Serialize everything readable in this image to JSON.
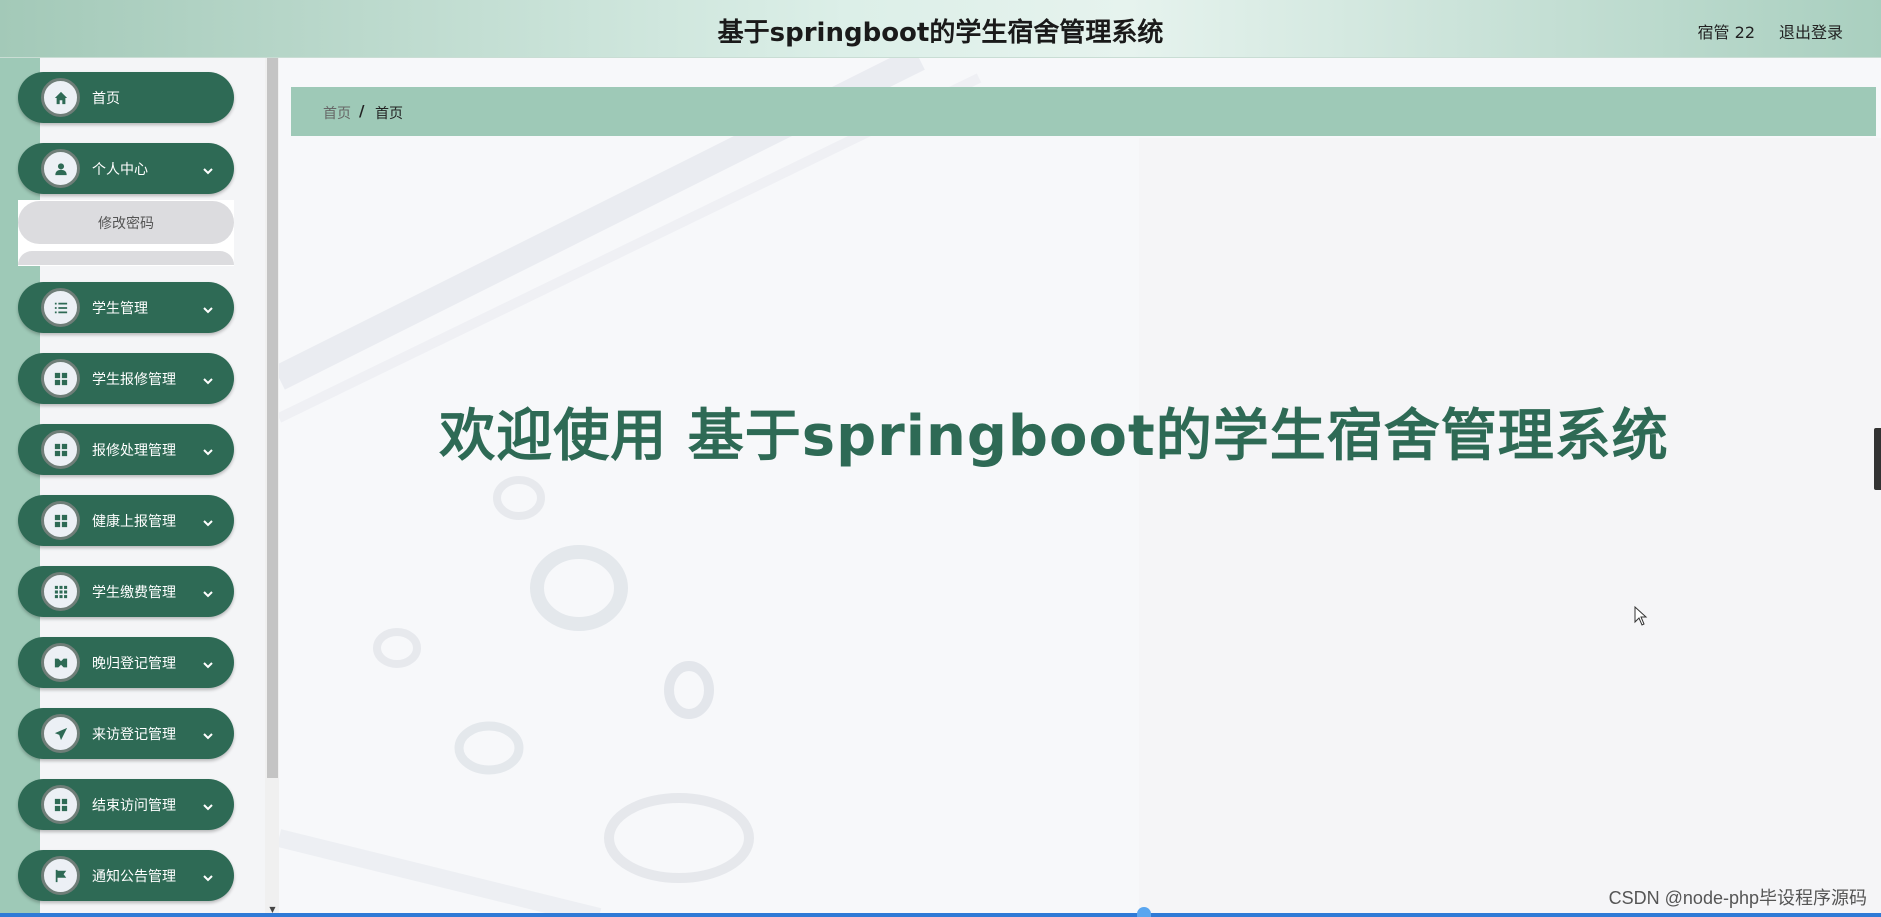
{
  "header": {
    "title": "基于springboot的学生宿舍管理系统",
    "user": "宿管 22",
    "logout": "退出登录"
  },
  "sidebar": {
    "items": [
      {
        "label": "首页",
        "icon": "home-icon"
      },
      {
        "label": "个人中心",
        "icon": "user-icon"
      },
      {
        "label": "学生管理",
        "icon": "list-icon"
      },
      {
        "label": "学生报修管理",
        "icon": "grid-icon"
      },
      {
        "label": "报修处理管理",
        "icon": "grid-icon"
      },
      {
        "label": "健康上报管理",
        "icon": "grid-icon"
      },
      {
        "label": "学生缴费管理",
        "icon": "apps-icon"
      },
      {
        "label": "晚归登记管理",
        "icon": "video-icon"
      },
      {
        "label": "来访登记管理",
        "icon": "send-icon"
      },
      {
        "label": "结束访问管理",
        "icon": "grid-icon"
      },
      {
        "label": "通知公告管理",
        "icon": "flag-icon"
      }
    ],
    "submenu": {
      "change_password": "修改密码"
    }
  },
  "breadcrumb": {
    "home": "首页",
    "separator": "/",
    "current": "首页"
  },
  "main": {
    "welcome": "欢迎使用 基于springboot的学生宿舍管理系统"
  },
  "watermark": "CSDN @node-php毕设程序源码",
  "colors": {
    "primary": "#2e6a55",
    "accent_light": "#9ec9b7",
    "submenu_bg": "#dcdcdf"
  }
}
